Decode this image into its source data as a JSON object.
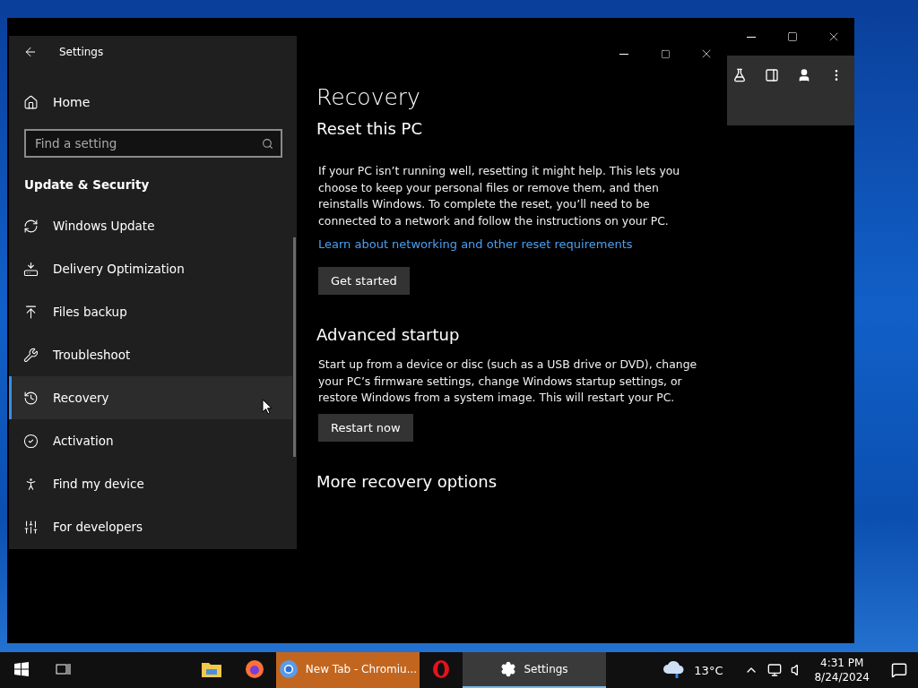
{
  "settings_window": {
    "title": "Settings",
    "nav": {
      "home": "Home",
      "search": {
        "placeholder": "Find a setting"
      },
      "section": "Update & Security",
      "items": [
        {
          "label": "Windows Update",
          "selected": false
        },
        {
          "label": "Delivery Optimization",
          "selected": false
        },
        {
          "label": "Files backup",
          "selected": false
        },
        {
          "label": "Troubleshoot",
          "selected": false
        },
        {
          "label": "Recovery",
          "selected": true
        },
        {
          "label": "Activation",
          "selected": false
        },
        {
          "label": "Find my device",
          "selected": false
        },
        {
          "label": "For developers",
          "selected": false
        }
      ]
    },
    "page": {
      "title": "Recovery",
      "sections": [
        {
          "heading": "Reset this PC",
          "body": "If your PC isn’t running well, resetting it might help. This lets you choose to keep your personal files or remove them, and then reinstalls Windows. To complete the reset, you’ll need to be connected to a network and follow the instructions on your PC.",
          "link": "Learn about networking and other reset requirements",
          "button": "Get started"
        },
        {
          "heading": "Advanced startup",
          "body": "Start up from a device or disc (such as a USB drive or DVD), change your PC’s firmware settings, change Windows startup settings, or restore Windows from a system image. This will restart your PC.",
          "button": "Restart now"
        },
        {
          "heading": "More recovery options"
        }
      ]
    }
  },
  "taskbar": {
    "apps": [
      {
        "kind": "explorer",
        "selected": false
      },
      {
        "kind": "firefox",
        "selected": false
      },
      {
        "kind": "chromium",
        "label": "New Tab - Chromiu...",
        "selected": false,
        "flashing": true
      },
      {
        "kind": "opera",
        "selected": false
      },
      {
        "kind": "settings",
        "label": "Settings",
        "selected": true
      }
    ],
    "weather": "13°C",
    "time": "4:31 PM",
    "date": "8/24/2024"
  }
}
